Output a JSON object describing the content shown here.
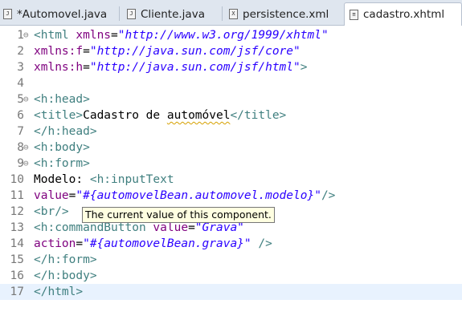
{
  "tabs": [
    {
      "label": "*Automovel.java",
      "icon": "java-file-icon",
      "icon_glyph": "J"
    },
    {
      "label": "Cliente.java",
      "icon": "java-file-icon",
      "icon_glyph": "J"
    },
    {
      "label": "persistence.xml",
      "icon": "xml-file-icon",
      "icon_glyph": "X"
    },
    {
      "label": "cadastro.xhtml",
      "icon": "xhtml-file-icon",
      "icon_glyph": "≡",
      "active": true
    }
  ],
  "editor": {
    "current_line": 17,
    "lines": [
      {
        "n": "1",
        "fold": "⊖",
        "segs": [
          [
            "tag",
            "<html "
          ],
          [
            "attr",
            "xmlns"
          ],
          [
            "txt",
            "="
          ],
          [
            "val",
            "\"http://www.w3.org/1999/xhtml\""
          ]
        ]
      },
      {
        "n": "2",
        "fold": "",
        "segs": [
          [
            "attr",
            "xmlns:f"
          ],
          [
            "txt",
            "="
          ],
          [
            "val",
            "\"http://java.sun.com/jsf/core\""
          ]
        ]
      },
      {
        "n": "3",
        "fold": "",
        "segs": [
          [
            "attr",
            "xmlns:h"
          ],
          [
            "txt",
            "="
          ],
          [
            "val",
            "\"http://java.sun.com/jsf/html\""
          ],
          [
            "tag",
            ">"
          ]
        ]
      },
      {
        "n": "4",
        "fold": "",
        "segs": []
      },
      {
        "n": "5",
        "fold": "⊖",
        "segs": [
          [
            "tag",
            "<h:head>"
          ]
        ]
      },
      {
        "n": "6",
        "fold": "",
        "segs": [
          [
            "tag",
            "<title>"
          ],
          [
            "txt",
            "Cadastro de "
          ],
          [
            "squig",
            "automóvel"
          ],
          [
            "tag",
            "</title>"
          ]
        ]
      },
      {
        "n": "7",
        "fold": "",
        "segs": [
          [
            "tag",
            "</h:head>"
          ]
        ]
      },
      {
        "n": "8",
        "fold": "⊖",
        "segs": [
          [
            "tag",
            "<h:body>"
          ]
        ]
      },
      {
        "n": "9",
        "fold": "⊖",
        "segs": [
          [
            "tag",
            "<h:form>"
          ]
        ]
      },
      {
        "n": "10",
        "fold": "",
        "segs": [
          [
            "txt",
            "Modelo: "
          ],
          [
            "tag",
            "<h:inputText"
          ]
        ]
      },
      {
        "n": "11",
        "fold": "",
        "segs": [
          [
            "attr",
            "value"
          ],
          [
            "txt",
            "="
          ],
          [
            "val",
            "\"#{automovelBean.automovel.modelo}\""
          ],
          [
            "tag",
            "/>"
          ]
        ]
      },
      {
        "n": "12",
        "fold": "",
        "segs": [
          [
            "tag",
            "<br/>"
          ]
        ]
      },
      {
        "n": "13",
        "fold": "",
        "segs": [
          [
            "tag",
            "<h:commandButton "
          ],
          [
            "attr",
            "value"
          ],
          [
            "txt",
            "="
          ],
          [
            "val",
            "\"Grava\""
          ]
        ]
      },
      {
        "n": "14",
        "fold": "",
        "segs": [
          [
            "attr",
            "action"
          ],
          [
            "txt",
            "="
          ],
          [
            "val",
            "\"#{automovelBean.grava}\""
          ],
          [
            "txt",
            " "
          ],
          [
            "tag",
            "/>"
          ]
        ]
      },
      {
        "n": "15",
        "fold": "",
        "segs": [
          [
            "tag",
            "</h:form>"
          ]
        ]
      },
      {
        "n": "16",
        "fold": "",
        "segs": [
          [
            "tag",
            "</h:body>"
          ]
        ]
      },
      {
        "n": "17",
        "fold": "",
        "segs": [
          [
            "tag",
            "</html>"
          ]
        ]
      }
    ]
  },
  "tooltip": {
    "text": "The current value of this component."
  }
}
